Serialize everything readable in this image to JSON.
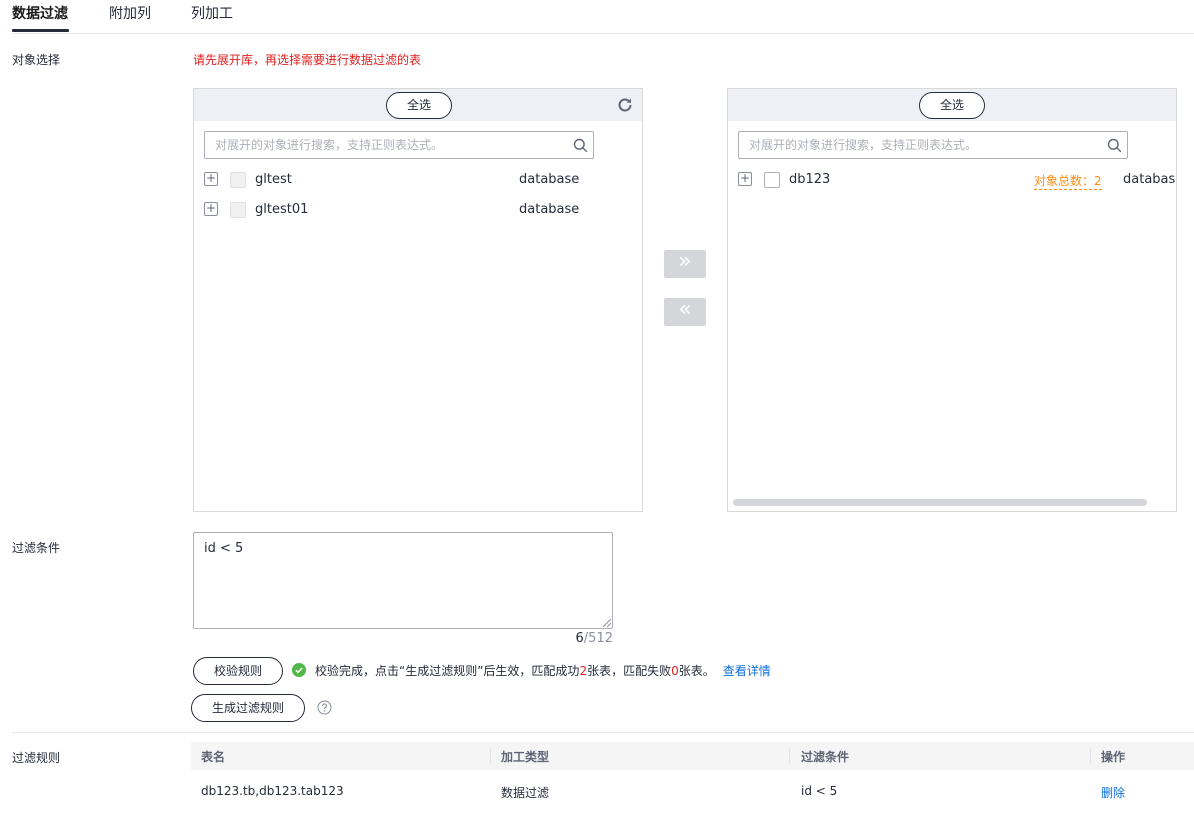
{
  "tabs": [
    {
      "label": "数据过滤",
      "active": true
    },
    {
      "label": "附加列",
      "active": false
    },
    {
      "label": "列加工",
      "active": false
    }
  ],
  "object_select": {
    "label": "对象选择",
    "hint": "请先展开库，再选择需要进行数据过滤的表",
    "left_panel": {
      "select_all": "全选",
      "search_placeholder": "对展开的对象进行搜索，支持正则表达式。",
      "items": [
        {
          "name": "gltest",
          "type": "database"
        },
        {
          "name": "gltest01",
          "type": "database"
        }
      ]
    },
    "right_panel": {
      "select_all": "全选",
      "search_placeholder": "对展开的对象进行搜索，支持正则表达式。",
      "items": [
        {
          "name": "db123",
          "count_text": "对象总数：2",
          "type": "database"
        }
      ]
    }
  },
  "filter": {
    "label": "过滤条件",
    "value": "id < 5",
    "count": "6",
    "max": "/512",
    "validate_button": "校验规则",
    "status": {
      "part1": "校验完成，点击“生成过滤规则”后生效，匹配成功",
      "success_count": "2",
      "part2": "张表，匹配失败",
      "fail_count": "0",
      "part3": "张表。",
      "link": "查看详情"
    },
    "generate_button": "生成过滤规则"
  },
  "rules": {
    "label": "过滤规则",
    "columns": [
      "表名",
      "加工类型",
      "过滤条件",
      "操作"
    ],
    "rows": [
      {
        "table": "db123.tb,db123.tab123",
        "type": "数据过滤",
        "condition": "id < 5",
        "action": "删除"
      }
    ]
  },
  "colors": {
    "accent": "#0c6fd9",
    "warning": "#e02020",
    "count": "#fa8c16",
    "success": "#50b848"
  }
}
